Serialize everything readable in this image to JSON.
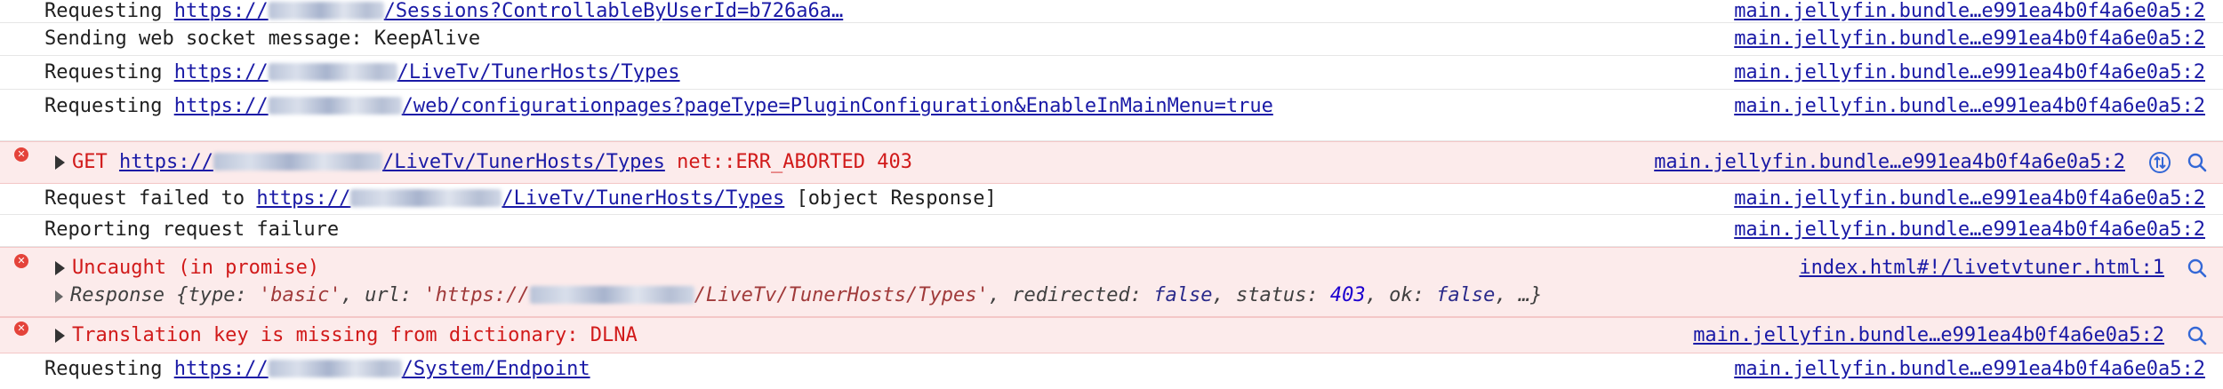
{
  "rows": [
    {
      "kind": "log",
      "prefix": "Requesting ",
      "url_scheme": "https://",
      "url_path": "/Sessions?ControllableByUserId=b726a6a…",
      "source": "main.jellyfin.bundle…e991ea4b0f4a6e0a5:2"
    },
    {
      "kind": "log",
      "text": "Sending web socket message: KeepAlive",
      "source": "main.jellyfin.bundle…e991ea4b0f4a6e0a5:2"
    },
    {
      "kind": "log",
      "prefix": "Requesting ",
      "url_scheme": "https://",
      "url_path": "/LiveTv/TunerHosts/Types",
      "source": "main.jellyfin.bundle…e991ea4b0f4a6e0a5:2"
    },
    {
      "kind": "log",
      "prefix": "Requesting ",
      "url_scheme": "https://",
      "url_path": "/web/configurationpages?pageType=PluginConfiguration&EnableInMainMenu=true",
      "source": "main.jellyfin.bundle…e991ea4b0f4a6e0a5:2"
    },
    {
      "kind": "error",
      "method": "GET ",
      "url_scheme": "https://",
      "url_path": "/LiveTv/TunerHosts/Types",
      "status": " net::ERR_ABORTED 403",
      "source": "main.jellyfin.bundle…e991ea4b0f4a6e0a5:2"
    },
    {
      "kind": "log",
      "prefix": "Request failed to ",
      "url_scheme": "https://",
      "url_path": "/LiveTv/TunerHosts/Types",
      "suffix": " [object Response]",
      "source": "main.jellyfin.bundle…e991ea4b0f4a6e0a5:2"
    },
    {
      "kind": "log",
      "text": "Reporting request failure",
      "source": "main.jellyfin.bundle…e991ea4b0f4a6e0a5:2"
    },
    {
      "kind": "error",
      "text": "Uncaught (in promise)",
      "source": "index.html#!/livetvtuner.html:1"
    },
    {
      "kind": "error",
      "text": "Translation key is missing from dictionary: DLNA",
      "source": "main.jellyfin.bundle…e991ea4b0f4a6e0a5:2"
    },
    {
      "kind": "log",
      "prefix": "Requesting ",
      "url_scheme": "https://",
      "url_path": "/System/Endpoint",
      "source": "main.jellyfin.bundle…e991ea4b0f4a6e0a5:2"
    }
  ],
  "response_obj": {
    "label": "Response ",
    "open": "{",
    "type_key": "type: ",
    "type_val": "'basic'",
    "url_key": "url: ",
    "url_open": "'https://",
    "url_rest": "/LiveTv/TunerHosts/Types'",
    "redirected_key": "redirected: ",
    "redirected_val": "false",
    "status_key": "status: ",
    "status_val": "403",
    "ok_key": "ok: ",
    "ok_val": "false",
    "tail": ", …}"
  },
  "icons": {
    "error": "error-circle-icon",
    "expand": "expand-triangle-icon",
    "network": "network-request-icon",
    "search": "search-icon"
  },
  "colors": {
    "error_text": "#d11a1a",
    "error_bg": "#fcebeb",
    "link": "#1a1aa6"
  }
}
